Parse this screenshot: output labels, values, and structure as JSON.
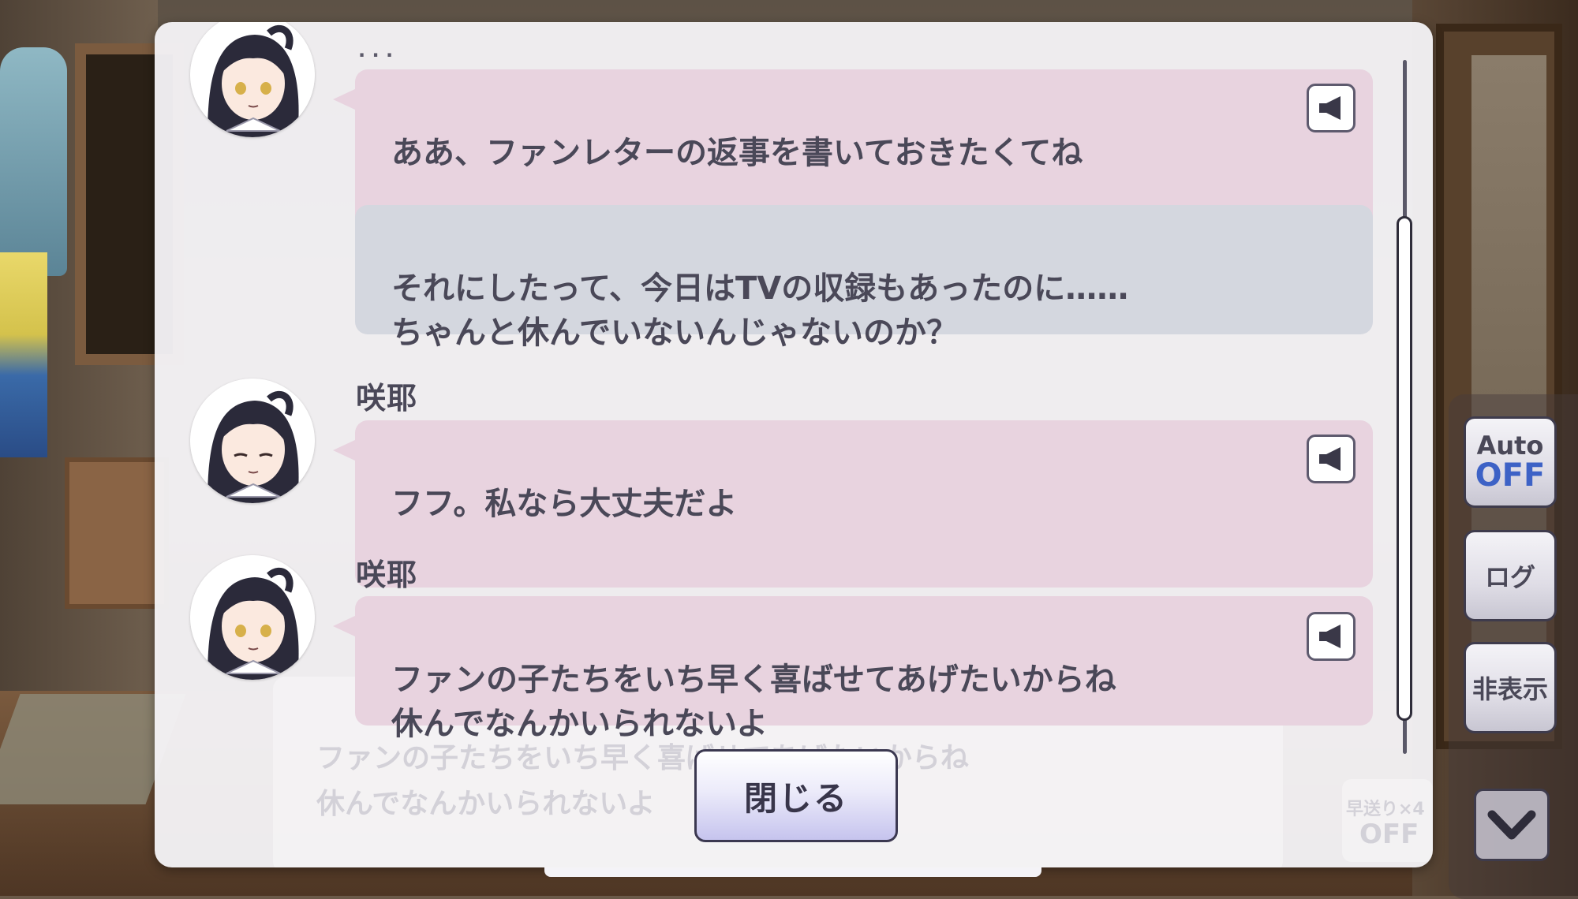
{
  "ghost": {
    "line_1": "ファンの子たちをいち早く喜ばせてあげたいからね",
    "line_2": "休んでなんかいられないよ",
    "fastforward_label": "早送り×4",
    "fastforward_state": "OFF",
    "top_name_fragment": "· · ·"
  },
  "log": {
    "messages": [
      {
        "speaker": "",
        "text": "ああ、ファンレターの返事を書いておきたくてね",
        "has_voice": true
      },
      {
        "speaker": "",
        "text": "それにしたって、今日はTVの収録もあったのに……\nちゃんと休んでいないんじゃないのか？",
        "has_voice": false
      },
      {
        "speaker": "咲耶",
        "text": "フフ。私なら大丈夫だよ",
        "has_voice": true
      },
      {
        "speaker": "咲耶",
        "text": "ファンの子たちをいち早く喜ばせてあげたいからね\n休んでなんかいられないよ",
        "has_voice": true
      }
    ],
    "close_label": "閉じる"
  },
  "controls": {
    "auto_label": "Auto",
    "auto_state": "OFF",
    "log_label": "ログ",
    "hide_label": "非表示"
  },
  "icons": {
    "voice": "speaker-icon",
    "down": "chevron-down-icon"
  },
  "colors": {
    "pink_bubble": "#e8d3df",
    "gray_bubble": "#d4d7df",
    "auto_off": "#3d62c6"
  }
}
